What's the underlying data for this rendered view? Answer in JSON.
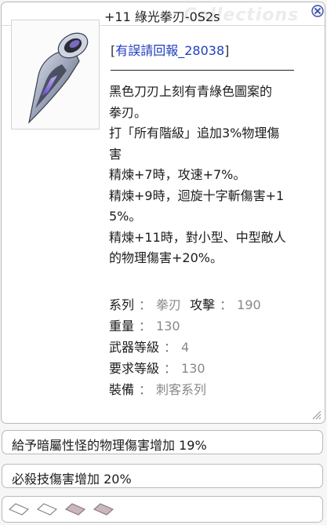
{
  "window": {
    "title": "+11 綠光拳刃-0S2s",
    "watermark": "Collections"
  },
  "item": {
    "report_prefix": "[",
    "report_link": "有誤請回報_28038",
    "report_suffix": "]",
    "description": [
      "黑色刀刃上刻有青綠色圖案的",
      "拳刃。",
      "打「所有階級」追加3%物理傷",
      "害",
      "精煉+7時，攻速+7%。",
      "精煉+9時，迴旋十字斬傷害+1",
      "5%。",
      "精煉+11時，對小型、中型敵人",
      "的物理傷害+20%。"
    ],
    "stats": {
      "type_label": "系列",
      "type_value": "拳刃",
      "attack_label": "攻擊",
      "attack_value": "190",
      "weight_label": "重量",
      "weight_value": "130",
      "weapon_level_label": "武器等級",
      "weapon_level_value": "4",
      "required_level_label": "要求等級",
      "required_level_value": "130",
      "equip_label": "裝備",
      "equip_value": "刺客系列",
      "separator": "："
    }
  },
  "options": [
    "給予暗屬性怪的物理傷害增加 19%",
    "必殺技傷害增加 20%"
  ],
  "cards": {
    "slots": [
      "empty",
      "empty",
      "locked",
      "locked"
    ]
  },
  "icons": {
    "close": "close-icon",
    "resize": "resize-grip-icon",
    "item": "katar-weapon-icon",
    "card_empty": "empty-card-slot-icon",
    "card_locked": "locked-card-slot-icon"
  },
  "colors": {
    "link": "#1f3fbf",
    "stat_value": "#888888",
    "close": "#3b4fa0",
    "katar_blade": "#9aa3b7",
    "katar_accent": "#7a5fd0",
    "slot_empty": "#ffffff",
    "slot_locked": "#c9b7bd"
  }
}
